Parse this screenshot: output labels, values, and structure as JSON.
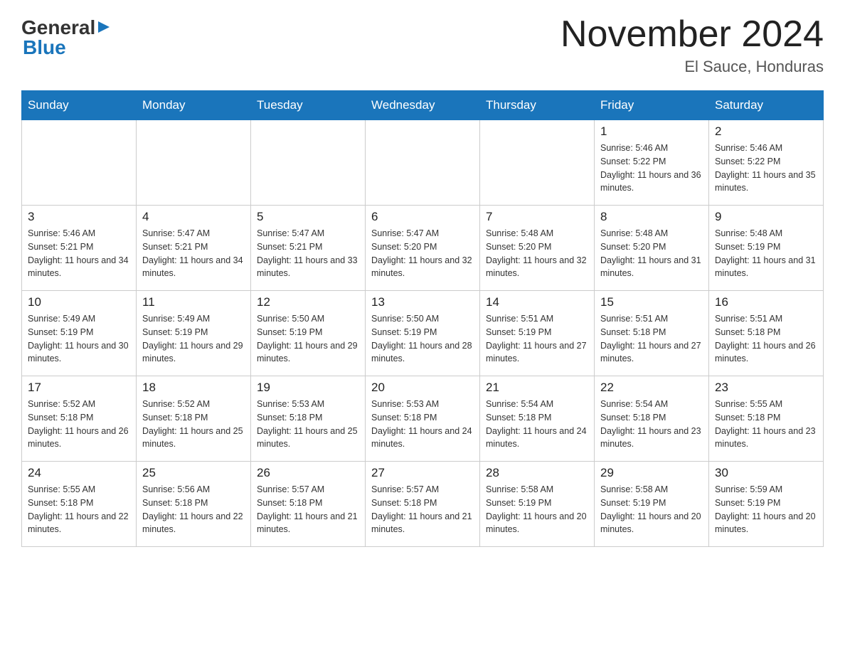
{
  "header": {
    "logo_general": "General",
    "logo_blue": "Blue",
    "title": "November 2024",
    "location": "El Sauce, Honduras"
  },
  "days_of_week": [
    "Sunday",
    "Monday",
    "Tuesday",
    "Wednesday",
    "Thursday",
    "Friday",
    "Saturday"
  ],
  "weeks": [
    [
      {
        "day": "",
        "info": ""
      },
      {
        "day": "",
        "info": ""
      },
      {
        "day": "",
        "info": ""
      },
      {
        "day": "",
        "info": ""
      },
      {
        "day": "",
        "info": ""
      },
      {
        "day": "1",
        "info": "Sunrise: 5:46 AM\nSunset: 5:22 PM\nDaylight: 11 hours and 36 minutes."
      },
      {
        "day": "2",
        "info": "Sunrise: 5:46 AM\nSunset: 5:22 PM\nDaylight: 11 hours and 35 minutes."
      }
    ],
    [
      {
        "day": "3",
        "info": "Sunrise: 5:46 AM\nSunset: 5:21 PM\nDaylight: 11 hours and 34 minutes."
      },
      {
        "day": "4",
        "info": "Sunrise: 5:47 AM\nSunset: 5:21 PM\nDaylight: 11 hours and 34 minutes."
      },
      {
        "day": "5",
        "info": "Sunrise: 5:47 AM\nSunset: 5:21 PM\nDaylight: 11 hours and 33 minutes."
      },
      {
        "day": "6",
        "info": "Sunrise: 5:47 AM\nSunset: 5:20 PM\nDaylight: 11 hours and 32 minutes."
      },
      {
        "day": "7",
        "info": "Sunrise: 5:48 AM\nSunset: 5:20 PM\nDaylight: 11 hours and 32 minutes."
      },
      {
        "day": "8",
        "info": "Sunrise: 5:48 AM\nSunset: 5:20 PM\nDaylight: 11 hours and 31 minutes."
      },
      {
        "day": "9",
        "info": "Sunrise: 5:48 AM\nSunset: 5:19 PM\nDaylight: 11 hours and 31 minutes."
      }
    ],
    [
      {
        "day": "10",
        "info": "Sunrise: 5:49 AM\nSunset: 5:19 PM\nDaylight: 11 hours and 30 minutes."
      },
      {
        "day": "11",
        "info": "Sunrise: 5:49 AM\nSunset: 5:19 PM\nDaylight: 11 hours and 29 minutes."
      },
      {
        "day": "12",
        "info": "Sunrise: 5:50 AM\nSunset: 5:19 PM\nDaylight: 11 hours and 29 minutes."
      },
      {
        "day": "13",
        "info": "Sunrise: 5:50 AM\nSunset: 5:19 PM\nDaylight: 11 hours and 28 minutes."
      },
      {
        "day": "14",
        "info": "Sunrise: 5:51 AM\nSunset: 5:19 PM\nDaylight: 11 hours and 27 minutes."
      },
      {
        "day": "15",
        "info": "Sunrise: 5:51 AM\nSunset: 5:18 PM\nDaylight: 11 hours and 27 minutes."
      },
      {
        "day": "16",
        "info": "Sunrise: 5:51 AM\nSunset: 5:18 PM\nDaylight: 11 hours and 26 minutes."
      }
    ],
    [
      {
        "day": "17",
        "info": "Sunrise: 5:52 AM\nSunset: 5:18 PM\nDaylight: 11 hours and 26 minutes."
      },
      {
        "day": "18",
        "info": "Sunrise: 5:52 AM\nSunset: 5:18 PM\nDaylight: 11 hours and 25 minutes."
      },
      {
        "day": "19",
        "info": "Sunrise: 5:53 AM\nSunset: 5:18 PM\nDaylight: 11 hours and 25 minutes."
      },
      {
        "day": "20",
        "info": "Sunrise: 5:53 AM\nSunset: 5:18 PM\nDaylight: 11 hours and 24 minutes."
      },
      {
        "day": "21",
        "info": "Sunrise: 5:54 AM\nSunset: 5:18 PM\nDaylight: 11 hours and 24 minutes."
      },
      {
        "day": "22",
        "info": "Sunrise: 5:54 AM\nSunset: 5:18 PM\nDaylight: 11 hours and 23 minutes."
      },
      {
        "day": "23",
        "info": "Sunrise: 5:55 AM\nSunset: 5:18 PM\nDaylight: 11 hours and 23 minutes."
      }
    ],
    [
      {
        "day": "24",
        "info": "Sunrise: 5:55 AM\nSunset: 5:18 PM\nDaylight: 11 hours and 22 minutes."
      },
      {
        "day": "25",
        "info": "Sunrise: 5:56 AM\nSunset: 5:18 PM\nDaylight: 11 hours and 22 minutes."
      },
      {
        "day": "26",
        "info": "Sunrise: 5:57 AM\nSunset: 5:18 PM\nDaylight: 11 hours and 21 minutes."
      },
      {
        "day": "27",
        "info": "Sunrise: 5:57 AM\nSunset: 5:18 PM\nDaylight: 11 hours and 21 minutes."
      },
      {
        "day": "28",
        "info": "Sunrise: 5:58 AM\nSunset: 5:19 PM\nDaylight: 11 hours and 20 minutes."
      },
      {
        "day": "29",
        "info": "Sunrise: 5:58 AM\nSunset: 5:19 PM\nDaylight: 11 hours and 20 minutes."
      },
      {
        "day": "30",
        "info": "Sunrise: 5:59 AM\nSunset: 5:19 PM\nDaylight: 11 hours and 20 minutes."
      }
    ]
  ]
}
